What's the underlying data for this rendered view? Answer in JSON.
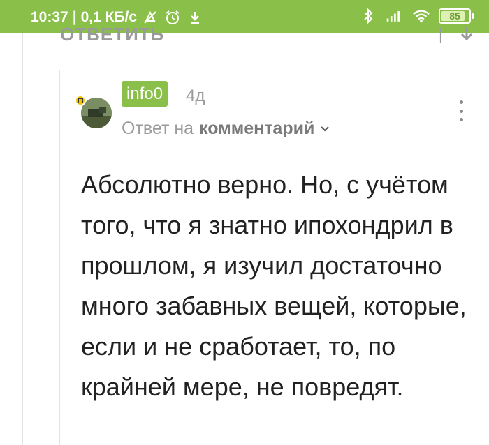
{
  "status_bar": {
    "time": "10:37",
    "speed": "0,1 КБ/с",
    "battery": "85",
    "colors": {
      "bar": "#8ac04a",
      "text": "#ffffff"
    },
    "icons": [
      "alarm-off-icon",
      "alarm-icon",
      "download-icon",
      "bluetooth-icon",
      "signal-icon",
      "wifi-icon",
      "battery-icon"
    ]
  },
  "previous_comment": {
    "reply_label": "ОТВЕТИТЬ"
  },
  "comment": {
    "author": "info0",
    "age": "4д",
    "reply_to_prefix": "Ответ на",
    "reply_to_link": "комментарий",
    "text": "Абсолютно верно. Но, с учётом того, что я знатно ипохондрил в прошлом, я изучил достаточно много забавных вещей, которые, если и не сработает, то, по крайней мере, не повредят."
  },
  "accent_color": "#8ac04a"
}
